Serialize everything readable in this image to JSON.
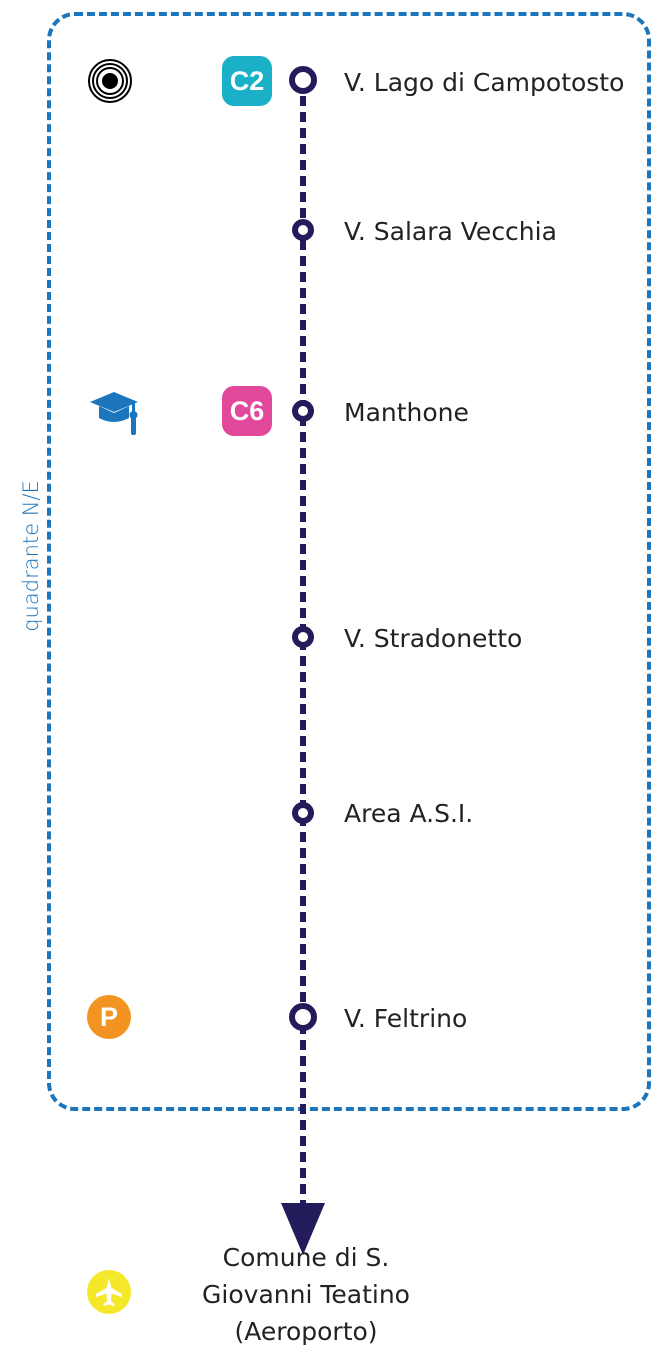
{
  "zone": {
    "label": "quadrante N/E",
    "color": "#1b76bd"
  },
  "line": {
    "color": "#221d5a"
  },
  "stops": [
    {
      "name": "V. Lago di Campotosto",
      "terminal": true
    },
    {
      "name": "V. Salara Vecchia",
      "terminal": false
    },
    {
      "name": "Manthone",
      "terminal": false
    },
    {
      "name": "V. Stradonetto",
      "terminal": false
    },
    {
      "name": "Area A.S.I.",
      "terminal": false
    },
    {
      "name": "V. Feltrino",
      "terminal": true
    }
  ],
  "badges": [
    {
      "label": "C2",
      "color": "#1ab0c8"
    },
    {
      "label": "C6",
      "color": "#e1489a"
    }
  ],
  "icons": {
    "target": "target-icon",
    "university": "graduation-cap-icon",
    "parking": {
      "name": "parking-icon",
      "label": "P",
      "color": "#f39321"
    },
    "airport": {
      "name": "airplane-icon",
      "color": "#f5e82a"
    }
  },
  "destination": {
    "lines": [
      "Comune di S.",
      "Giovanni Teatino",
      "(Aeroporto)"
    ]
  }
}
